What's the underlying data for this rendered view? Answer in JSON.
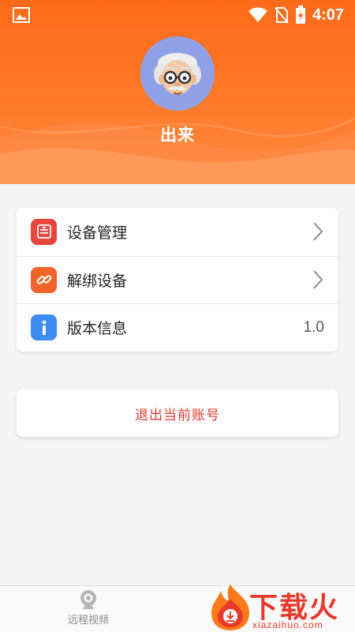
{
  "status_bar": {
    "time": "4:07",
    "icons": [
      "image-icon",
      "wifi-icon",
      "no-sim-icon",
      "battery-charging-icon"
    ]
  },
  "profile": {
    "username": "出来",
    "avatar_icon": "grandpa-avatar-icon"
  },
  "menu": {
    "items": [
      {
        "label": "设备管理",
        "icon": "device-manage-icon",
        "icon_color": "#e8453c",
        "trailing": "chevron"
      },
      {
        "label": "解绑设备",
        "icon": "link-icon",
        "icon_color": "#f0642a",
        "trailing": "chevron"
      },
      {
        "label": "版本信息",
        "icon": "info-icon",
        "icon_color": "#3d8cf0",
        "value": "1.0"
      }
    ]
  },
  "logout": {
    "label": "退出当前账号"
  },
  "bottom_nav": {
    "items": [
      {
        "label": "远程视频",
        "icon": "camera-icon"
      }
    ]
  },
  "watermark": {
    "brand": "下载火",
    "url": "xiazaihuo.com"
  },
  "colors": {
    "header": "#ff6a1a",
    "logout_text": "#e03a2e",
    "background": "#f4f4f4"
  }
}
